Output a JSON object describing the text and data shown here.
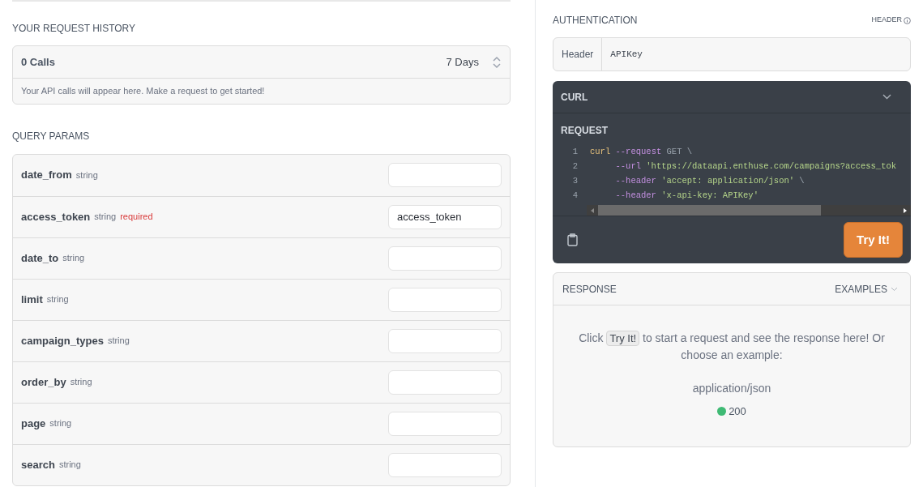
{
  "history": {
    "title": "YOUR REQUEST HISTORY",
    "calls": "0 Calls",
    "range": "7 Days",
    "note": "Your API calls will appear here. Make a request to get started!"
  },
  "query_params": {
    "title": "QUERY PARAMS",
    "params": [
      {
        "name": "date_from",
        "type": "string"
      },
      {
        "name": "access_token",
        "type": "string",
        "required": "required",
        "value": "access_token"
      },
      {
        "name": "date_to",
        "type": "string"
      },
      {
        "name": "limit",
        "type": "string"
      },
      {
        "name": "campaign_types",
        "type": "string"
      },
      {
        "name": "order_by",
        "type": "string"
      },
      {
        "name": "page",
        "type": "string"
      },
      {
        "name": "search",
        "type": "string"
      }
    ]
  },
  "authentication": {
    "title": "AUTHENTICATION",
    "type_label": "HEADER",
    "field_label": "Header",
    "value": "APIKey"
  },
  "curl": {
    "title": "CURL",
    "subtitle": "REQUEST",
    "lines": [
      {
        "number": "1",
        "tokens": [
          {
            "kind": "command",
            "text": "curl"
          },
          {
            "kind": "flag",
            "text": " --request"
          },
          {
            "kind": "plain",
            "text": " GET \\"
          }
        ]
      },
      {
        "number": "2",
        "tokens": [
          {
            "kind": "flag",
            "text": "     --url"
          },
          {
            "kind": "string",
            "text": " 'https://dataapi.enthuse.com/campaigns?access_tok"
          }
        ]
      },
      {
        "number": "3",
        "tokens": [
          {
            "kind": "flag",
            "text": "     --header"
          },
          {
            "kind": "string",
            "text": " 'accept: application/json'"
          },
          {
            "kind": "plain",
            "text": " \\"
          }
        ]
      },
      {
        "number": "4",
        "tokens": [
          {
            "kind": "flag",
            "text": "     --header"
          },
          {
            "kind": "string",
            "text": " 'x-api-key: APIKey'"
          }
        ]
      }
    ],
    "button": "Try It!"
  },
  "response": {
    "title": "RESPONSE",
    "examples": "EXAMPLES",
    "text_before": "Click",
    "inline_button": "Try It!",
    "text_after": "to start a request and see the response here! Or choose an example:",
    "media_type": "application/json",
    "status": {
      "code": "200",
      "color": "#3fba74"
    }
  }
}
